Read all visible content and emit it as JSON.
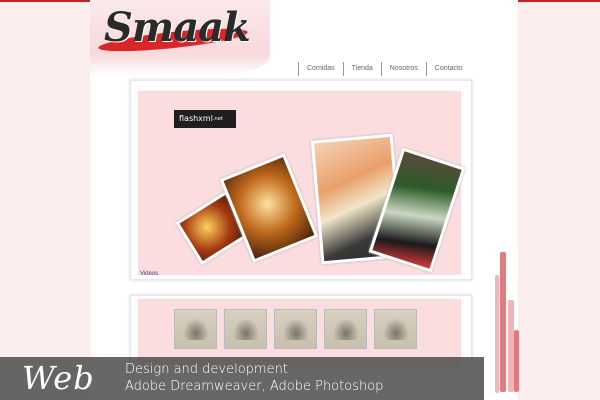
{
  "site": {
    "logo_text": "Smaak"
  },
  "nav": {
    "items": [
      {
        "label": "Comidas"
      },
      {
        "label": "Tienda"
      },
      {
        "label": "Nosotros"
      },
      {
        "label": "Contacto"
      }
    ]
  },
  "flash": {
    "badge": "flashxml",
    "badge_sup": ".net",
    "videos_label": "Videos"
  },
  "gallery": {
    "thumbnail_count": 5
  },
  "banner": {
    "title": "Web",
    "line1": "Design and development",
    "line2": "Adobe Dreamweaver, Adobe Photoshop"
  },
  "colors": {
    "accent": "#d9262b",
    "background": "#fdeeee",
    "panel": "#fbdcdf",
    "banner": "#464646"
  }
}
